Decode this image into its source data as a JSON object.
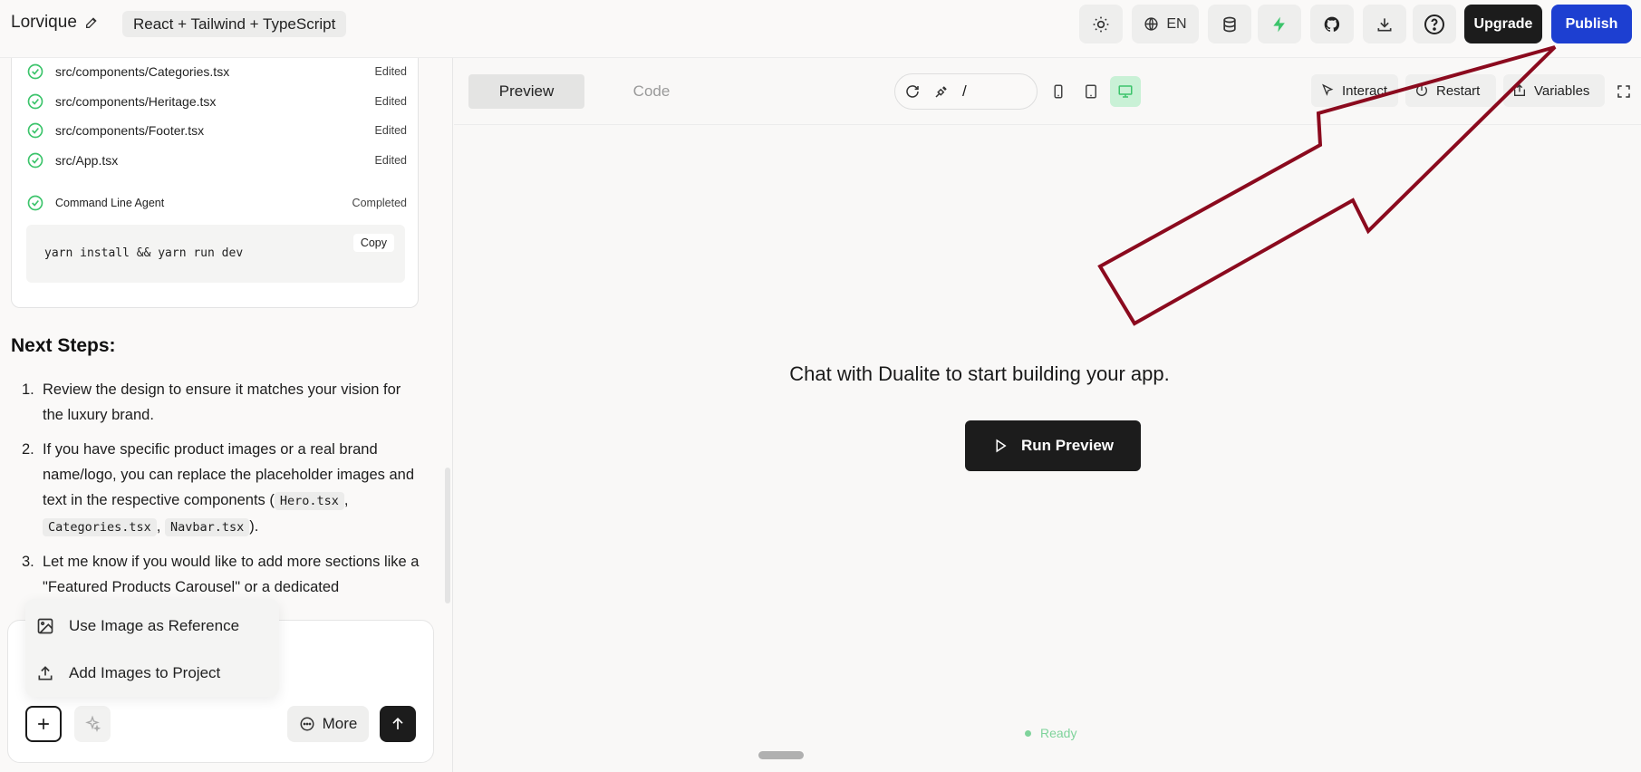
{
  "header": {
    "project_name": "Lorvique",
    "stack": "React + Tailwind + TypeScript",
    "language": "EN",
    "upgrade_label": "Upgrade",
    "publish_label": "Publish"
  },
  "files": [
    {
      "path": "src/components/Categories.tsx",
      "status": "Edited"
    },
    {
      "path": "src/components/Heritage.tsx",
      "status": "Edited"
    },
    {
      "path": "src/components/Footer.tsx",
      "status": "Edited"
    },
    {
      "path": "src/App.tsx",
      "status": "Edited"
    }
  ],
  "command": {
    "agent": "Command Line Agent",
    "status": "Completed",
    "code": "yarn install && yarn run dev",
    "copy_label": "Copy"
  },
  "next_steps": {
    "title": "Next Steps:",
    "items": [
      {
        "num": "1.",
        "text": "Review the design to ensure it matches your vision for the luxury brand."
      },
      {
        "num": "2.",
        "text_a": "If you have specific product images or a real brand name/logo, you can replace the placeholder images and text in the respective components (",
        "code1": "Hero.tsx",
        "sep1": ",",
        "code2": "Categories.tsx",
        "sep2": ",",
        "code3": "Navbar.tsx",
        "end": ")."
      },
      {
        "num": "3.",
        "text": "Let me know if you would like to add more sections like a \"Featured Products Carousel\" or a dedicated"
      }
    ]
  },
  "popup": {
    "item1": "Use Image as Reference",
    "item2": "Add Images to Project"
  },
  "chat": {
    "more_label": "More"
  },
  "preview": {
    "tab_preview": "Preview",
    "tab_code": "Code",
    "url_path": "/",
    "interact_label": "Interact",
    "restart_label": "Restart",
    "variables_label": "Variables",
    "empty_message": "Chat with Dualite to start building your app.",
    "run_label": "Run Preview",
    "status": "Ready"
  },
  "colors": {
    "publish": "#1d3fd1",
    "accent_green": "#3cc46b",
    "arrow": "#8b0a1e"
  }
}
